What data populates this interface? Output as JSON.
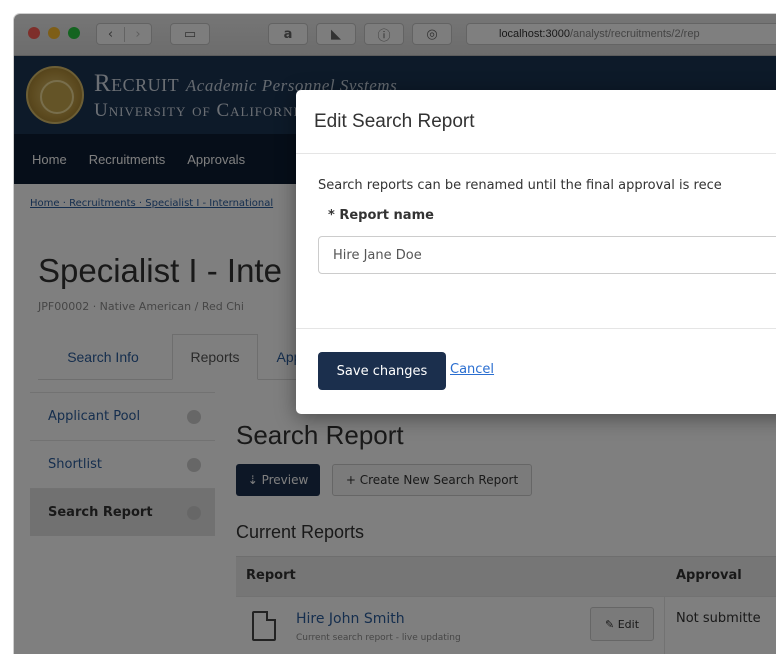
{
  "browser": {
    "url_host": "localhost:3000",
    "url_path": "/analyst/recruitments/2/rep"
  },
  "banner": {
    "line1_main": "Recruit",
    "line1_italic": "Academic Personnel Systems",
    "line2": "University of California"
  },
  "nav": {
    "items": [
      "Home",
      "Recruitments",
      "Approvals"
    ]
  },
  "breadcrumb": "Home  ·  Recruitments  ·  Specialist I - International",
  "page": {
    "title": "Specialist I - Inte",
    "subtitle": "JPF00002 · Native American / Red Chi"
  },
  "tabs": [
    "Search Info",
    "Reports",
    "App"
  ],
  "sidebar": {
    "items": [
      {
        "label": "Applicant Pool"
      },
      {
        "label": "Shortlist"
      },
      {
        "label": "Search Report"
      }
    ]
  },
  "main": {
    "heading": "Search Report",
    "preview_label": "Preview",
    "new_report_label": "Create New Search Report",
    "current_reports_heading": "Current Reports",
    "table": {
      "col_report": "Report",
      "col_approval": "Approval",
      "row": {
        "name": "Hire John Smith",
        "sub": "Current search report - live updating",
        "edit_label": "Edit",
        "approval": "Not submitte"
      }
    }
  },
  "modal": {
    "title": "Edit Search Report",
    "description": "Search reports can be renamed until the final approval is rece",
    "field_label": "* Report name",
    "field_value": "Hire Jane Doe",
    "save_label": "Save changes",
    "cancel_label": "Cancel"
  },
  "colors": {
    "banner": "#1b3453",
    "nav": "#0d1d33",
    "primary_button": "#1b2f4d",
    "link": "#2a5c9c"
  }
}
